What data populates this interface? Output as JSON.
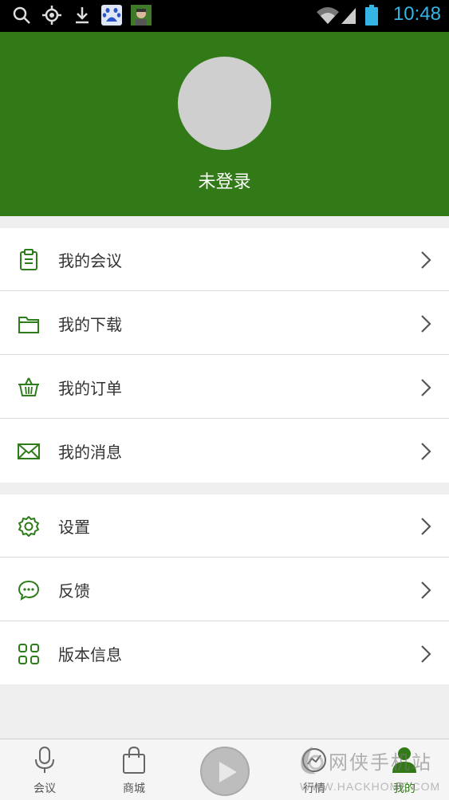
{
  "status_bar": {
    "time": "10:48",
    "icons": [
      "search-icon",
      "location-icon",
      "download-icon",
      "baidu-icon",
      "avatar-notification-icon",
      "wifi-icon",
      "signal-icon",
      "battery-icon"
    ]
  },
  "header": {
    "login_label": "未登录"
  },
  "menu_group_1": [
    {
      "label": "我的会议",
      "icon": "clipboard-icon"
    },
    {
      "label": "我的下载",
      "icon": "folder-icon"
    },
    {
      "label": "我的订单",
      "icon": "basket-icon"
    },
    {
      "label": "我的消息",
      "icon": "envelope-icon"
    }
  ],
  "menu_group_2": [
    {
      "label": "设置",
      "icon": "gear-icon"
    },
    {
      "label": "反馈",
      "icon": "chat-bubble-icon"
    },
    {
      "label": "版本信息",
      "icon": "grid-icon"
    }
  ],
  "bottom_nav": {
    "tabs": [
      {
        "label": "会议",
        "icon": "microphone-icon"
      },
      {
        "label": "商城",
        "icon": "shopping-bag-icon"
      },
      {
        "label": "行情",
        "icon": "chart-icon"
      },
      {
        "label": "我的",
        "icon": "person-icon",
        "active": true
      }
    ]
  },
  "watermark": {
    "text": "网侠手机站",
    "url": "WWW.HACKHOME.COM"
  },
  "colors": {
    "header_green": "#327a17",
    "icon_green": "#2e7d1b",
    "status_time": "#34b5e5"
  }
}
